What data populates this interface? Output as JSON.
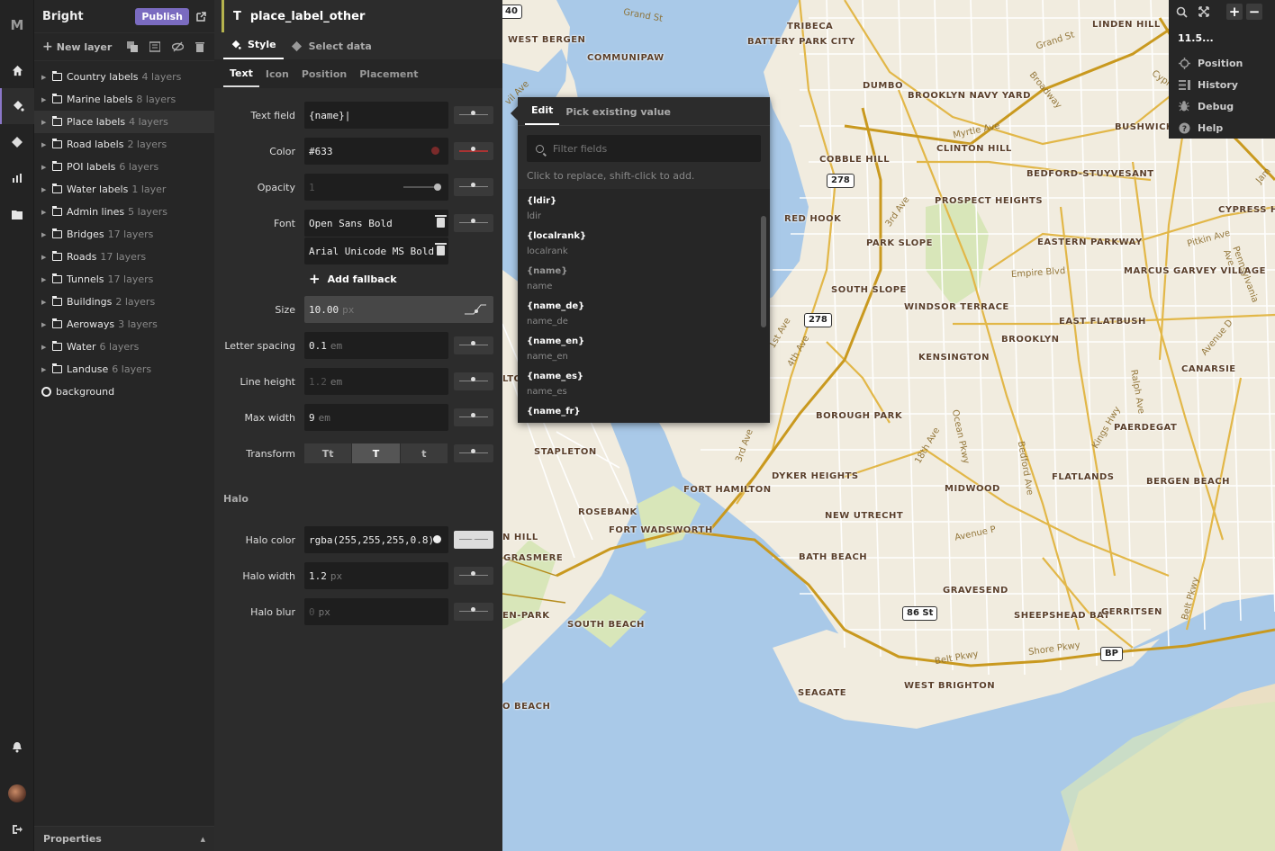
{
  "app": {
    "logo": "M"
  },
  "rail": {
    "icons": [
      "home-icon",
      "paint-bucket-icon",
      "sources-icon",
      "stats-icon",
      "folder-icon",
      "bell-icon",
      "avatar",
      "logout-icon"
    ]
  },
  "layers_panel": {
    "title": "Bright",
    "publish_label": "Publish",
    "new_layer_label": "New layer",
    "groups": [
      {
        "name": "Country labels",
        "count": "4 layers"
      },
      {
        "name": "Marine labels",
        "count": "8 layers"
      },
      {
        "name": "Place labels",
        "count": "4 layers"
      },
      {
        "name": "Road labels",
        "count": "2 layers"
      },
      {
        "name": "POI labels",
        "count": "6 layers"
      },
      {
        "name": "Water labels",
        "count": "1 layer"
      },
      {
        "name": "Admin lines",
        "count": "5 layers"
      },
      {
        "name": "Bridges",
        "count": "17 layers"
      },
      {
        "name": "Roads",
        "count": "17 layers"
      },
      {
        "name": "Tunnels",
        "count": "17 layers"
      },
      {
        "name": "Buildings",
        "count": "2 layers"
      },
      {
        "name": "Aeroways",
        "count": "3 layers"
      },
      {
        "name": "Water",
        "count": "6 layers"
      },
      {
        "name": "Landuse",
        "count": "6 layers"
      }
    ],
    "background_label": "background",
    "properties_label": "Properties"
  },
  "style_panel": {
    "type_glyph": "T",
    "layer_name": "place_label_other",
    "tabs": {
      "style": "Style",
      "select_data": "Select data"
    },
    "sub_tabs": {
      "text": "Text",
      "icon": "Icon",
      "position": "Position",
      "placement": "Placement"
    },
    "props": {
      "text_field": {
        "label": "Text field",
        "value": "{name}|"
      },
      "color": {
        "label": "Color",
        "value": "#633",
        "swatch": "#663333"
      },
      "opacity": {
        "label": "Opacity",
        "placeholder": "1"
      },
      "font": {
        "label": "Font",
        "value1": "Open Sans Bold",
        "value2": "Arial Unicode MS Bold"
      },
      "add_fallback": "Add fallback",
      "size": {
        "label": "Size",
        "value": "10.00",
        "unit": "px"
      },
      "letter_spacing": {
        "label": "Letter spacing",
        "value": "0.1",
        "unit": "em"
      },
      "line_height": {
        "label": "Line height",
        "placeholder": "1.2",
        "unit": "em"
      },
      "max_width": {
        "label": "Max width",
        "value": "9",
        "unit": "em"
      },
      "transform": {
        "label": "Transform",
        "options": [
          "Tt",
          "T",
          "t"
        ],
        "selected": "T"
      }
    },
    "halo_section": "Halo",
    "halo": {
      "color": {
        "label": "Halo color",
        "value": "rgba(255,255,255,0.8)"
      },
      "width": {
        "label": "Halo width",
        "value": "1.2",
        "unit": "px"
      },
      "blur": {
        "label": "Halo blur",
        "placeholder": "0",
        "unit": "px"
      }
    }
  },
  "popup": {
    "tabs": {
      "edit": "Edit",
      "pick": "Pick existing value"
    },
    "search_placeholder": "Filter fields",
    "hint": "Click to replace, shift-click to add.",
    "fields": [
      {
        "key": "{ldir}",
        "value": "ldir"
      },
      {
        "key": "{localrank}",
        "value": "localrank"
      },
      {
        "key": "{name}",
        "value": "name"
      },
      {
        "key": "{name_de}",
        "value": "name_de"
      },
      {
        "key": "{name_en}",
        "value": "name_en"
      },
      {
        "key": "{name_es}",
        "value": "name_es"
      },
      {
        "key": "{name_fr}",
        "value": ""
      }
    ]
  },
  "map_controls": {
    "zoom_value": "11.5...",
    "zoom_in": "+",
    "zoom_out": "−",
    "items": [
      "Position",
      "History",
      "Debug",
      "Help"
    ]
  },
  "map": {
    "places": [
      "TRIBECA",
      "BATTERY PARK CITY",
      "WEST BERGEN",
      "COMMUNIPAW",
      "DUMBO",
      "BROOKLYN NAVY YARD",
      "LINDEN HILL",
      "BUSHWICK",
      "CLINTON HILL",
      "COBBLE HILL",
      "BEDFORD-STUYVESANT",
      "PROSPECT HEIGHTS",
      "RED HOOK",
      "PARK SLOPE",
      "EASTERN PARKWAY",
      "CYPRESS HILLS",
      "MARCUS GARVEY VILLAGE",
      "SOUTH SLOPE",
      "WINDSOR TERRACE",
      "EAST FLATBUSH",
      "BROOKLYN",
      "KENSINGTON",
      "CANARSIE",
      "BOROUGH PARK",
      "PAERDEGAT",
      "STAPLETON",
      "DYKER HEIGHTS",
      "FLATLANDS",
      "BERGEN BEACH",
      "FORT HAMILTON",
      "MIDWOOD",
      "NEW UTRECHT",
      "ROSEBANK",
      "FORT WADSWORTH",
      "GRASMERE",
      "BATH BEACH",
      "GRAVESEND",
      "SHEEPSHEAD BAY",
      "GERRITSEN",
      "SOUTH BEACH",
      "SEAGATE",
      "WEST BRIGHTON",
      "N HILL",
      "EN-PARK",
      "O BEACH",
      "LTO"
    ],
    "shields": [
      "278",
      "278",
      "86 St",
      "BP",
      "40"
    ],
    "roads": [
      "Grand St",
      "Grand St",
      "Broadway",
      "Myrtle Ave",
      "3rd Ave",
      "Empire Blvd",
      "Pitkin Ave",
      "4th Ave",
      "1st Ave",
      "Ocean Pkwy",
      "18th Ave",
      "Bedford Ave",
      "Ralph Ave",
      "Kings Hwy",
      "3rd Ave",
      "Avenue P",
      "Avenue D",
      "Shore Pkwy",
      "Belt Pkwy",
      "Belt Pkwy",
      "Cypr",
      "Jam",
      "Pennsylvania Ave",
      "vil Ave"
    ]
  }
}
